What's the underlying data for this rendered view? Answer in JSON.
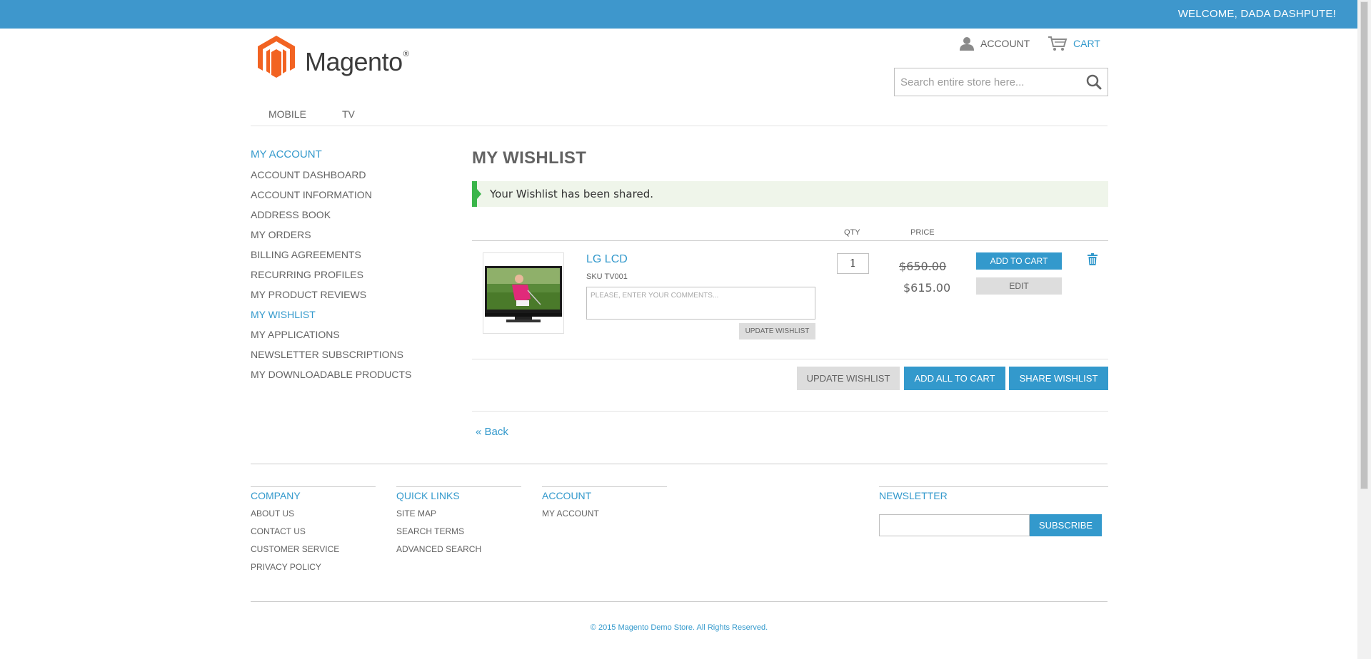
{
  "header": {
    "welcome": "WELCOME, DADA DASHPUTE!",
    "logo_text": "Magento",
    "logo_reg": "®",
    "account_label": "ACCOUNT",
    "cart_label": "CART",
    "search_placeholder": "Search entire store here..."
  },
  "nav": {
    "items": [
      {
        "label": "MOBILE"
      },
      {
        "label": "TV"
      }
    ]
  },
  "sidebar": {
    "title": "MY ACCOUNT",
    "items": [
      {
        "label": "ACCOUNT DASHBOARD"
      },
      {
        "label": "ACCOUNT INFORMATION"
      },
      {
        "label": "ADDRESS BOOK"
      },
      {
        "label": "MY ORDERS"
      },
      {
        "label": "BILLING AGREEMENTS"
      },
      {
        "label": "RECURRING PROFILES"
      },
      {
        "label": "MY PRODUCT REVIEWS"
      },
      {
        "label": "MY WISHLIST",
        "active": true
      },
      {
        "label": "MY APPLICATIONS"
      },
      {
        "label": "NEWSLETTER SUBSCRIPTIONS"
      },
      {
        "label": "MY DOWNLOADABLE PRODUCTS"
      }
    ]
  },
  "main": {
    "title": "MY WISHLIST",
    "message": "Your Wishlist has been shared.",
    "columns": {
      "qty": "QTY",
      "price": "PRICE"
    },
    "item": {
      "name": "LG LCD",
      "sku": "SKU TV001",
      "comment_placeholder": "PLEASE, ENTER YOUR COMMENTS...",
      "update_label": "UPDATE WISHLIST",
      "qty": "1",
      "old_price": "$650.00",
      "new_price": "$615.00",
      "add_to_cart_label": "ADD TO CART",
      "edit_label": "EDIT"
    },
    "actions": {
      "update": "UPDATE WISHLIST",
      "add_all": "ADD ALL TO CART",
      "share": "SHARE WISHLIST"
    },
    "back_label": "« Back"
  },
  "footer": {
    "company": {
      "heading": "COMPANY",
      "links": [
        "ABOUT US",
        "CONTACT US",
        "CUSTOMER SERVICE",
        "PRIVACY POLICY"
      ]
    },
    "quick_links": {
      "heading": "QUICK LINKS",
      "links": [
        "SITE MAP",
        "SEARCH TERMS",
        "ADVANCED SEARCH"
      ]
    },
    "account": {
      "heading": "ACCOUNT",
      "links": [
        "MY ACCOUNT"
      ]
    },
    "newsletter": {
      "heading": "NEWSLETTER",
      "subscribe_label": "SUBSCRIBE"
    },
    "copyright": "© 2015 Magento Demo Store. All Rights Reserved."
  },
  "colors": {
    "accent": "#3399cc",
    "topbar": "#3e97cc",
    "success": "#3ab54a",
    "logo_orange": "#f26322"
  }
}
